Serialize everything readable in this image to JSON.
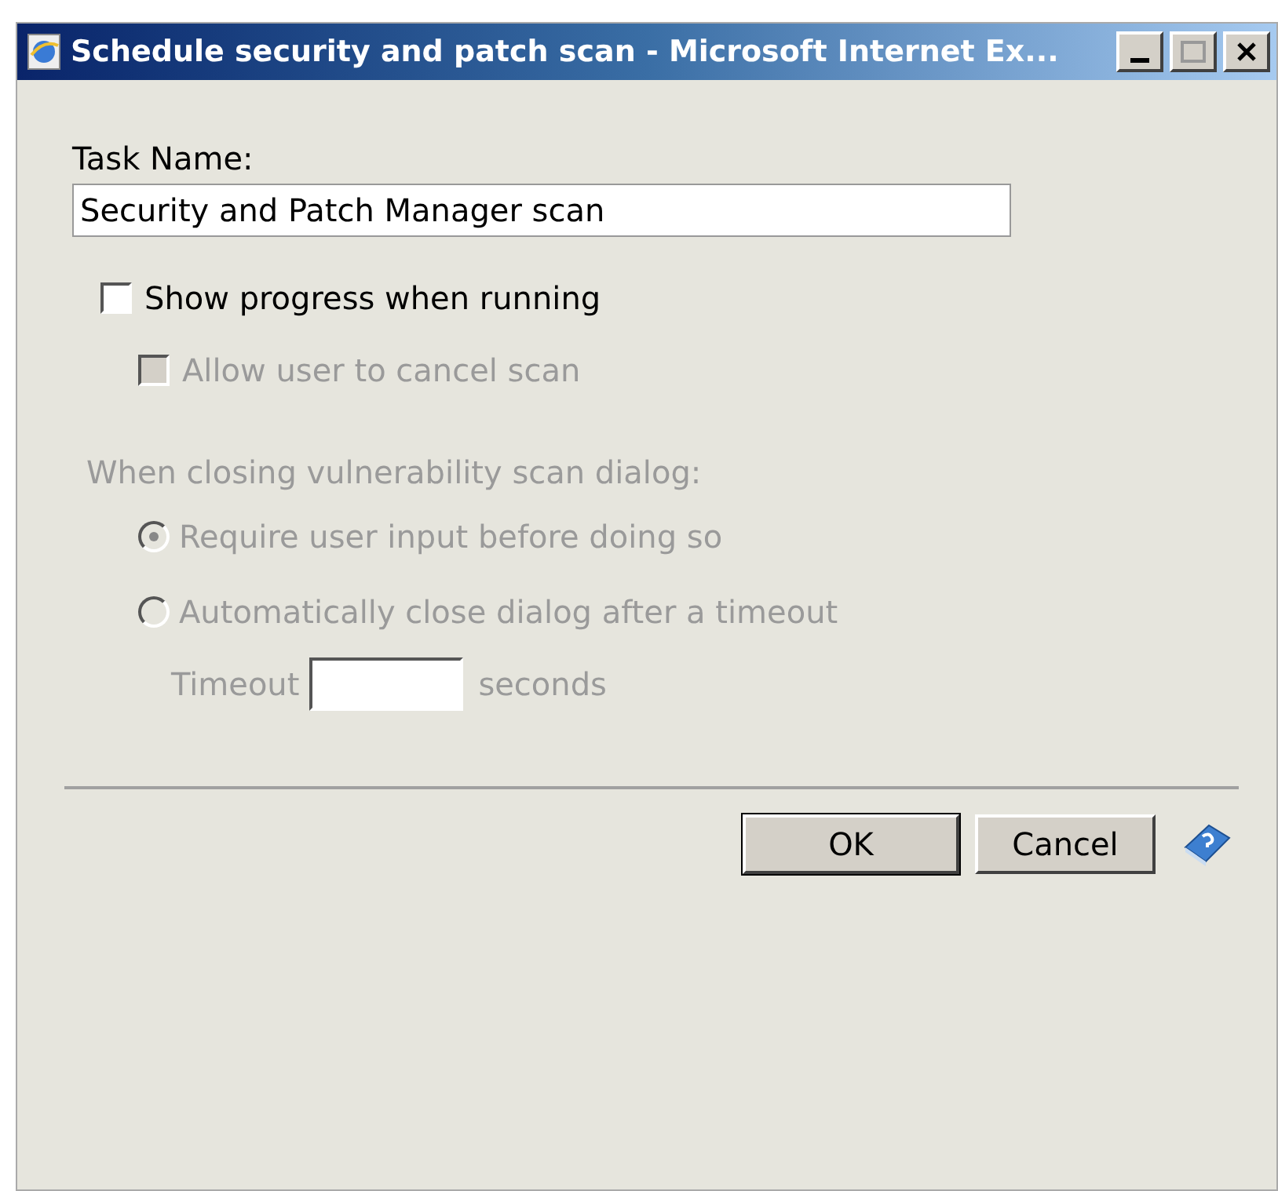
{
  "window": {
    "title": "Schedule security and patch scan - Microsoft Internet Ex..."
  },
  "task_name": {
    "label": "Task Name:",
    "value": "Security and Patch Manager scan"
  },
  "checkboxes": [
    {
      "label": "Show progress when running",
      "checked": false,
      "disabled": false
    },
    {
      "label": "Allow user to cancel scan",
      "checked": false,
      "disabled": true
    }
  ],
  "closing": {
    "label": "When closing vulnerability scan dialog:",
    "disabled": true,
    "options": [
      {
        "label": "Require user input before doing so",
        "selected": true
      },
      {
        "label": "Automatically close dialog after a timeout",
        "selected": false
      }
    ],
    "timeout": {
      "label": "Timeout",
      "unit": "seconds"
    }
  },
  "buttons": [
    {
      "label": "OK",
      "default": true
    },
    {
      "label": "Cancel",
      "default": false
    }
  ]
}
